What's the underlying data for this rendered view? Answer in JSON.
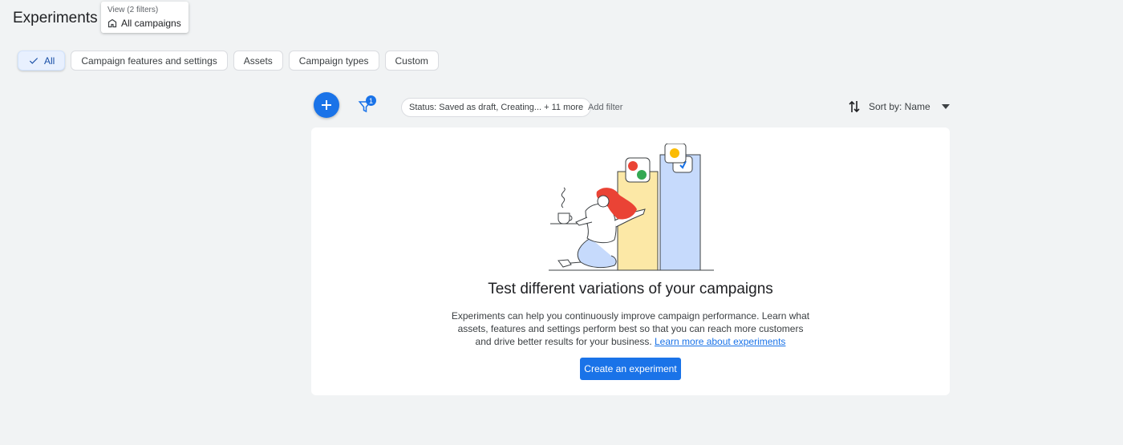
{
  "page": {
    "title": "Experiments"
  },
  "view": {
    "caption": "View (2 filters)",
    "value": "All campaigns",
    "icon": "building-icon"
  },
  "chips": [
    {
      "label": "All",
      "selected": true
    },
    {
      "label": "Campaign features and settings",
      "selected": false
    },
    {
      "label": "Assets",
      "selected": false
    },
    {
      "label": "Campaign types",
      "selected": false
    },
    {
      "label": "Custom",
      "selected": false
    }
  ],
  "toolbar": {
    "filter_count": "1",
    "status_filter": "Status: Saved as draft, Creating... + 11 more",
    "add_filter": "Add filter",
    "sort_label": "Sort by: Name"
  },
  "empty_state": {
    "title": "Test different variations of your campaigns",
    "description": "Experiments can help you continuously improve campaign performance. Learn what assets, features and settings perform best so that you can reach more customers and drive better results for your business.",
    "link": "Learn more about experiments",
    "button": "Create an experiment"
  },
  "colors": {
    "accent": "#1a73e8",
    "background": "#f1f3f4",
    "card": "#ffffff"
  }
}
